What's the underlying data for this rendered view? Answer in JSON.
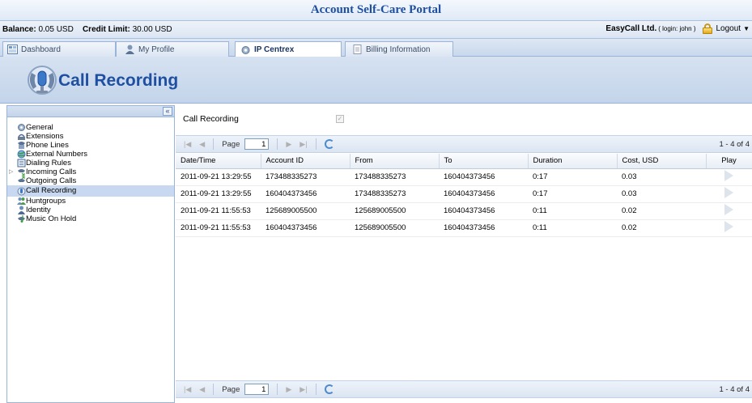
{
  "app": {
    "title": "Account Self-Care Portal"
  },
  "infobar": {
    "balance_label": "Balance:",
    "balance_value": "0.05 USD",
    "credit_label": "Credit Limit:",
    "credit_value": "30.00 USD",
    "company": "EasyCall Ltd.",
    "login": "( login: john )",
    "logout": "Logout"
  },
  "tabs": [
    {
      "label": "Dashboard"
    },
    {
      "label": "My Profile"
    },
    {
      "label": "IP Centrex",
      "active": true
    },
    {
      "label": "Billing Information"
    }
  ],
  "page": {
    "title": "Call Recording"
  },
  "sidebar": {
    "items": [
      {
        "label": "General"
      },
      {
        "label": "Extensions"
      },
      {
        "label": "Phone Lines"
      },
      {
        "label": "External Numbers"
      },
      {
        "label": "Dialing Rules"
      },
      {
        "label": "Incoming Calls",
        "expandable": true
      },
      {
        "label": "Outgoing Calls"
      },
      {
        "label": "Call Recording",
        "selected": true
      },
      {
        "label": "Huntgroups"
      },
      {
        "label": "Identity"
      },
      {
        "label": "Music On Hold"
      }
    ]
  },
  "content": {
    "call_recording_label": "Call Recording",
    "call_recording_checked": true,
    "pager": {
      "page_label": "Page",
      "page_value": "1",
      "count": "1 - 4 of 4"
    },
    "table": {
      "columns": [
        "Date/Time",
        "Account ID",
        "From",
        "To",
        "Duration",
        "Cost, USD",
        "Play"
      ],
      "rows": [
        [
          "2011-09-21 13:29:55",
          "173488335273",
          "173488335273",
          "160404373456",
          "0:17",
          "0.03"
        ],
        [
          "2011-09-21 13:29:55",
          "160404373456",
          "173488335273",
          "160404373456",
          "0:17",
          "0.03"
        ],
        [
          "2011-09-21 11:55:53",
          "125689005500",
          "125689005500",
          "160404373456",
          "0:11",
          "0.02"
        ],
        [
          "2011-09-21 11:55:53",
          "160404373456",
          "125689005500",
          "160404373456",
          "0:11",
          "0.02"
        ]
      ]
    }
  },
  "colors": {
    "accent": "#1f4fa0",
    "selected": "#c7d8f0",
    "border": "#99b4d8"
  }
}
